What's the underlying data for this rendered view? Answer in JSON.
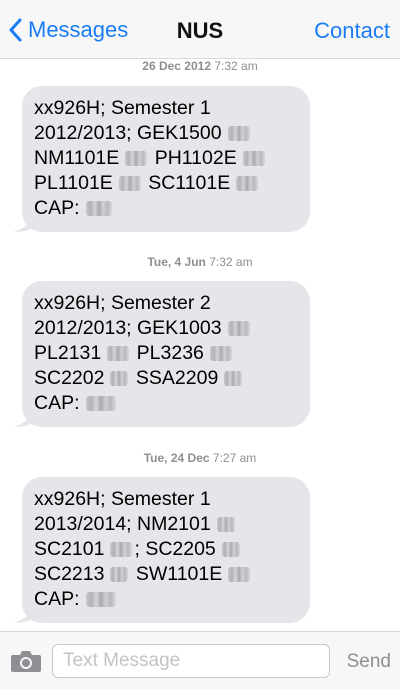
{
  "nav": {
    "back_label": "Messages",
    "title": "NUS",
    "contact_label": "Contact"
  },
  "accent_color": "#1a7cf5",
  "messages": [
    {
      "timestamp": {
        "date": "26 Dec 2012",
        "time": "7:32 am"
      },
      "lines": [
        "xx926H; Semester 1",
        "2012/2013; GEK1500",
        "NM1101E",
        "PH1102E",
        "PL1101E",
        "SC1101E",
        "CAP:"
      ]
    },
    {
      "timestamp": {
        "date": "Tue, 4 Jun",
        "time": "7:32 am"
      },
      "lines": [
        "xx926H; Semester 2",
        "2012/2013; GEK1003",
        "PL2131",
        "PL3236",
        "SC2202",
        "SSA2209",
        "CAP:"
      ]
    },
    {
      "timestamp": {
        "date": "Tue, 24 Dec",
        "time": "7:27 am"
      },
      "lines": [
        "xx926H; Semester 1",
        "2013/2014; NM2101",
        "SC2101",
        ";",
        "SC2205",
        "SC2213",
        "SW1101E",
        "CAP:"
      ]
    }
  ],
  "composer": {
    "camera_icon": "camera-icon",
    "placeholder": "Text Message",
    "value": "",
    "send_label": "Send"
  }
}
